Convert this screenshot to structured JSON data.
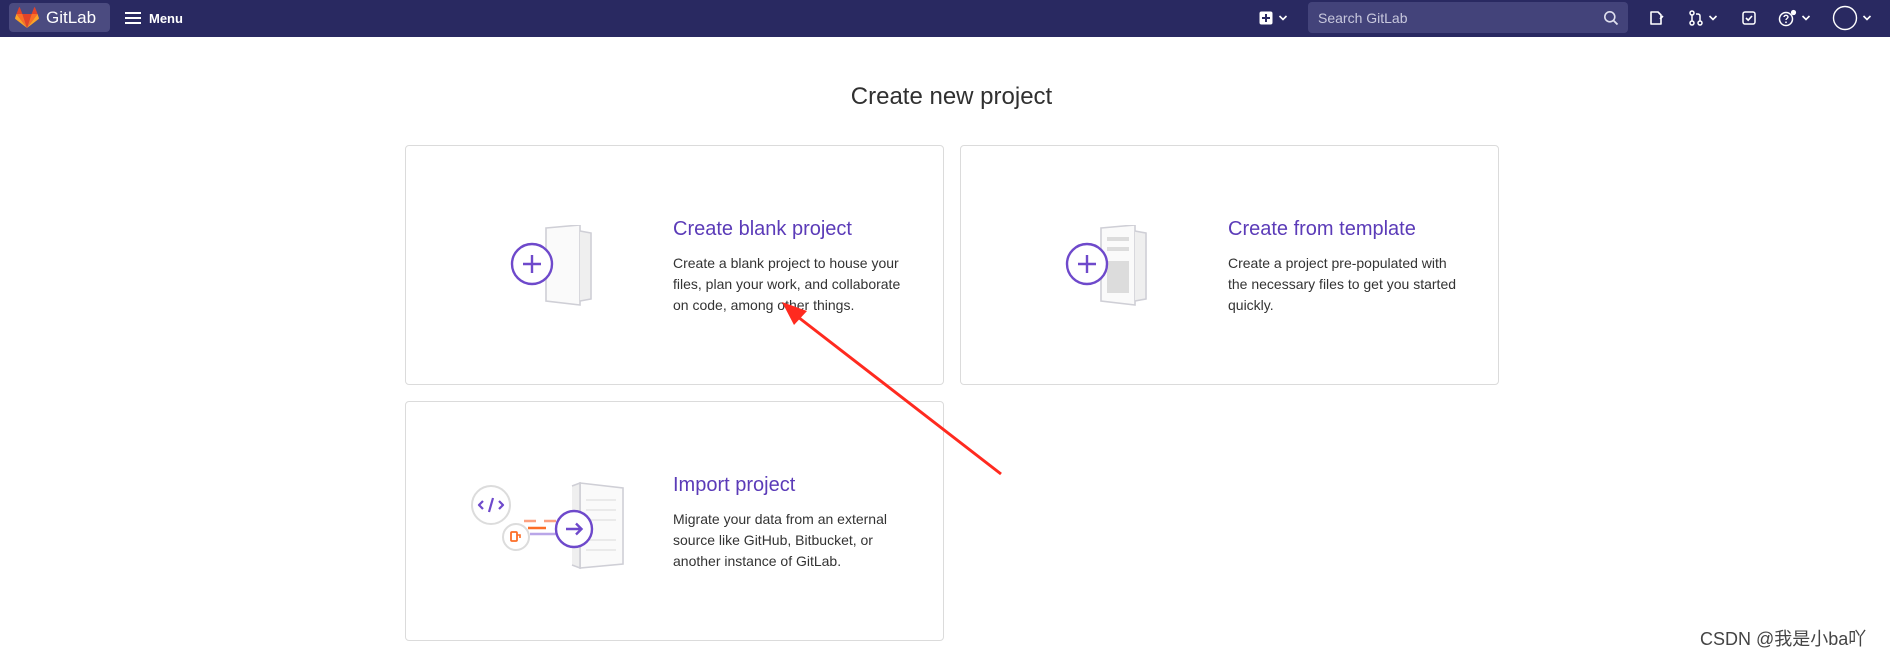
{
  "navbar": {
    "brand_name": "GitLab",
    "menu_label": "Menu",
    "search_placeholder": "Search GitLab",
    "icons": [
      "plus-square-icon",
      "chevron-down-icon",
      "search-icon",
      "issues-icon",
      "merge-request-icon",
      "todo-icon",
      "help-icon",
      "avatar-icon"
    ]
  },
  "page": {
    "title": "Create new project"
  },
  "cards": [
    {
      "title": "Create blank project",
      "description": "Create a blank project to house your files, plan your work, and collaborate on code, among other things."
    },
    {
      "title": "Create from template",
      "description": "Create a project pre-populated with the necessary files to get you started quickly."
    },
    {
      "title": "Import project",
      "description": "Migrate your data from an external source like GitHub, Bitbucket, or another instance of GitLab."
    }
  ],
  "watermark": "CSDN @我是小ba吖",
  "colors": {
    "navbar": "#292961",
    "accent": "#5b3bb8",
    "annotation_arrow": "#ff2a1f",
    "tanuki": "#e24329"
  }
}
